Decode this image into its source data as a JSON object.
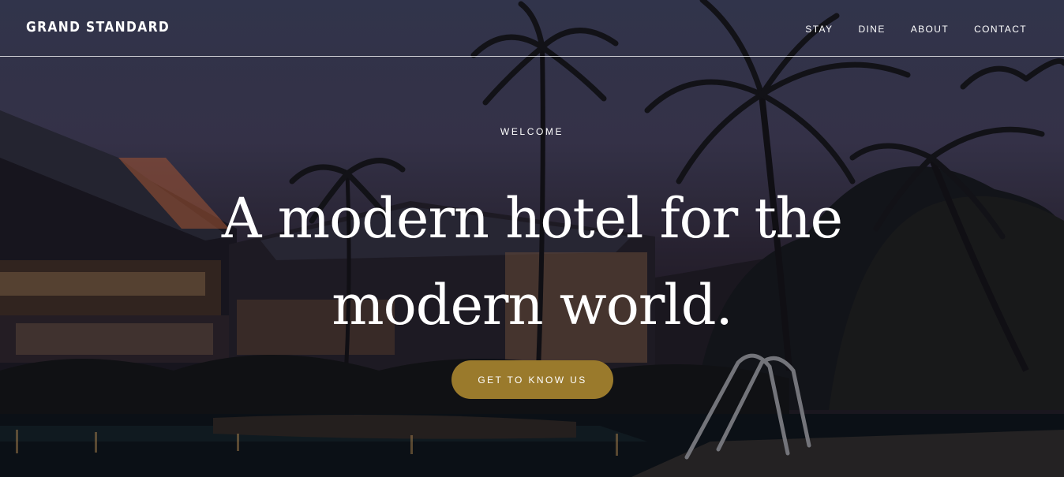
{
  "brand": "GRAND STANDARD",
  "nav": [
    "STAY",
    "DINE",
    "ABOUT",
    "CONTACT"
  ],
  "hero": {
    "eyebrow": "WELCOME",
    "headline_line1": "A modern hotel for the",
    "headline_line2": "modern world.",
    "cta_label": "GET TO KNOW US"
  },
  "colors": {
    "accent": "#9a7a2c",
    "text": "#ffffff"
  }
}
